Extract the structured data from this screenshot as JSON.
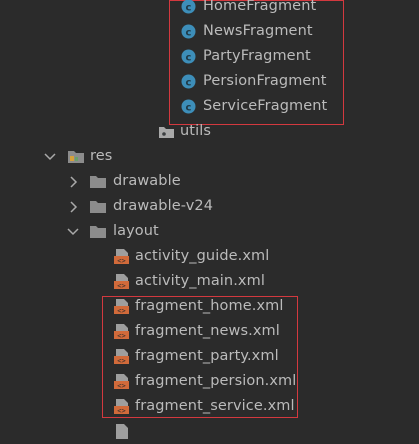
{
  "tree": {
    "fragment_classes": [
      {
        "label": "HomeFragment",
        "icon": "class-icon"
      },
      {
        "label": "NewsFragment",
        "icon": "class-icon"
      },
      {
        "label": "PartyFragment",
        "icon": "class-icon"
      },
      {
        "label": "PersionFragment",
        "icon": "class-icon"
      },
      {
        "label": "ServiceFragment",
        "icon": "class-icon"
      }
    ],
    "utils": {
      "label": "utils",
      "icon": "package-icon"
    },
    "res": {
      "label": "res",
      "icon": "res-folder-icon",
      "expanded": true
    },
    "res_children": [
      {
        "label": "drawable",
        "icon": "folder-icon",
        "expanded": false
      },
      {
        "label": "drawable-v24",
        "icon": "folder-icon",
        "expanded": false
      },
      {
        "label": "layout",
        "icon": "folder-icon",
        "expanded": true
      }
    ],
    "layout_files": [
      {
        "label": "activity_guide.xml",
        "icon": "layout-xml-icon"
      },
      {
        "label": "activity_main.xml",
        "icon": "layout-xml-icon"
      },
      {
        "label": "fragment_home.xml",
        "icon": "layout-xml-icon"
      },
      {
        "label": "fragment_news.xml",
        "icon": "layout-xml-icon"
      },
      {
        "label": "fragment_party.xml",
        "icon": "layout-xml-icon"
      },
      {
        "label": "fragment_persion.xml",
        "icon": "layout-xml-icon"
      },
      {
        "label": "fragment_service.xml",
        "icon": "layout-xml-icon"
      }
    ]
  },
  "colors": {
    "background": "#2b2b2b",
    "text": "#bbbbbb",
    "highlight_border": "#d3393f",
    "class_icon": "#3d8eb9",
    "xml_icon": "#d16a3a"
  }
}
